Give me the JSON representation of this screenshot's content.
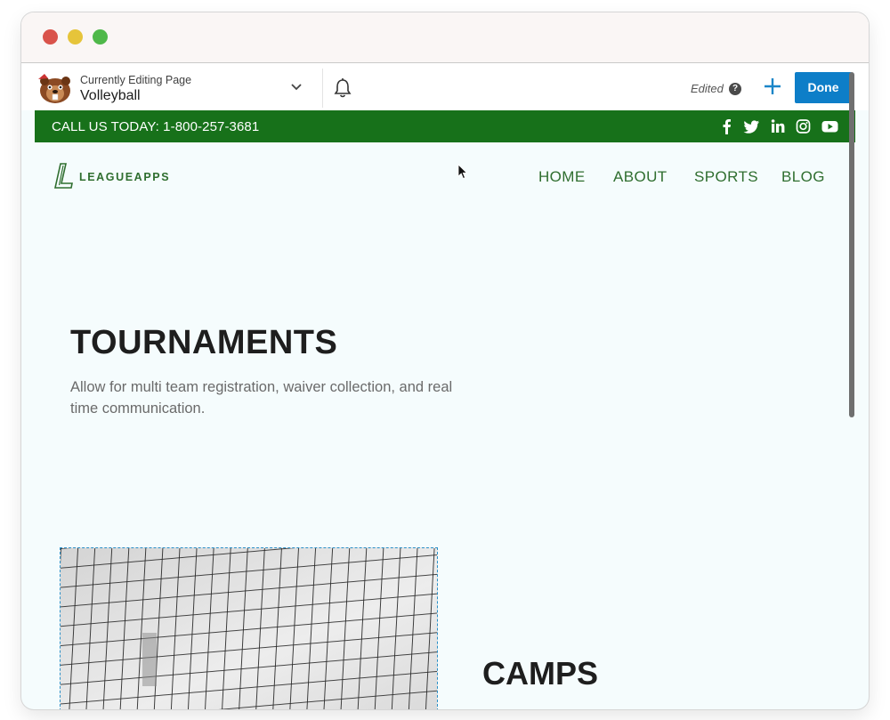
{
  "editor": {
    "editing_label": "Currently Editing Page",
    "page_name": "Volleyball",
    "status": "Edited",
    "help_symbol": "?",
    "done_label": "Done",
    "icons": [
      "beaver-logo-icon",
      "chevron-down-icon",
      "bell-icon",
      "help-icon",
      "plus-icon"
    ]
  },
  "topbar": {
    "call_text": "CALL US TODAY: 1-800-257-3681",
    "background": "#17711a",
    "social": [
      "facebook-icon",
      "twitter-icon",
      "linkedin-icon",
      "instagram-icon",
      "youtube-icon"
    ]
  },
  "site": {
    "logo_text": "LEAGUEAPPS",
    "nav": [
      "HOME",
      "ABOUT",
      "SPORTS",
      "BLOG"
    ],
    "accent": "#2f6e2f"
  },
  "hero": {
    "title": "TOURNAMENTS",
    "description": "Allow for multi team registration, waiver collection, and real time communication."
  },
  "section2": {
    "title": "CAMPS"
  },
  "colors": {
    "page_bg": "#f5fcfd",
    "done_button": "#0d7ec8"
  }
}
